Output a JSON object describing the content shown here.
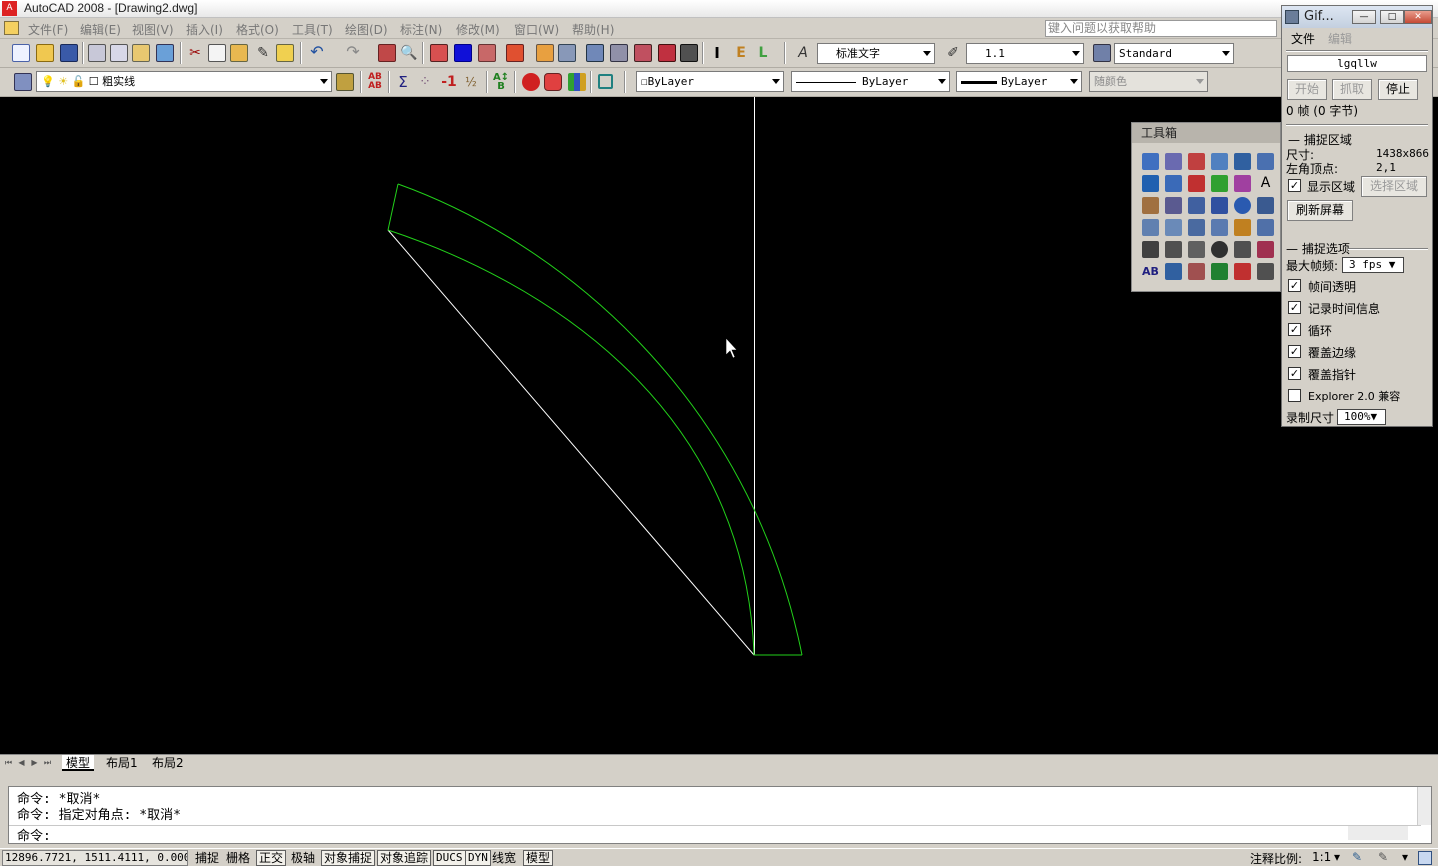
{
  "titlebar": {
    "title": "AutoCAD 2008 - [Drawing2.dwg]"
  },
  "menubar": {
    "items": [
      "文件(F)",
      "编辑(E)",
      "视图(V)",
      "插入(I)",
      "格式(O)",
      "工具(T)",
      "绘图(D)",
      "标注(N)",
      "修改(M)",
      "窗口(W)",
      "帮助(H)"
    ],
    "help_placeholder": "键入问题以获取帮助"
  },
  "styles_toolbar": {
    "text_style": "标准文字",
    "dim_scale": "1.1",
    "table_style": "Standard"
  },
  "layers_toolbar": {
    "layer": "粗实线",
    "color": "ByLayer",
    "linetype": "ByLayer",
    "lineweight": "ByLayer",
    "plotstyle": "随颜色"
  },
  "toolbox": {
    "title": "工具箱"
  },
  "gif_recorder": {
    "title": "Gif...",
    "menu": [
      "文件",
      "编辑"
    ],
    "name_field": "lgqllw",
    "buttons": {
      "start": "开始",
      "grab": "抓取",
      "stop": "停止"
    },
    "frames_info": "0 帧 (0 字节)",
    "capture_section": "捕捉区域",
    "size_label": "尺寸:",
    "size_value": "1438x866",
    "corner_label": "左角顶点:",
    "corner_value": "2,1",
    "show_region": "显示区域",
    "select_region": "选择区域",
    "refresh_screen": "刷新屏幕",
    "options_section": "捕捉选项",
    "max_fps_label": "最大帧频:",
    "max_fps_value": "3 fps",
    "options": [
      {
        "label": "帧间透明",
        "checked": true
      },
      {
        "label": "记录时间信息",
        "checked": true
      },
      {
        "label": "循环",
        "checked": true
      },
      {
        "label": "覆盖边缘",
        "checked": true
      },
      {
        "label": "覆盖指针",
        "checked": true
      },
      {
        "label": "Explorer 2.0 兼容",
        "checked": false
      }
    ],
    "record_size_label": "录制尺寸",
    "record_size_value": "100%"
  },
  "layout_tabs": [
    "模型",
    "布局1",
    "布局2"
  ],
  "command_window": {
    "lines": [
      "命令: *取消*",
      "命令: 指定对角点: *取消*"
    ],
    "prompt": "命令:"
  },
  "statusbar": {
    "coords": "12896.7721, 1511.4111, 0.0000",
    "toggles": [
      {
        "label": "捕捉",
        "on": false
      },
      {
        "label": "栅格",
        "on": false
      },
      {
        "label": "正交",
        "on": true
      },
      {
        "label": "极轴",
        "on": false
      },
      {
        "label": "对象捕捉",
        "on": true
      },
      {
        "label": "对象追踪",
        "on": true
      },
      {
        "label": "DUCS",
        "on": true
      },
      {
        "label": "DYN",
        "on": true
      },
      {
        "label": "线宽",
        "on": false
      },
      {
        "label": "模型",
        "on": true
      }
    ],
    "annotation_label": "注释比例:",
    "annotation_value": "1:1"
  },
  "colors": {
    "canvas_bg": "#000000",
    "geometry_green": "#22d01a",
    "construction_white": "#ffffff"
  }
}
